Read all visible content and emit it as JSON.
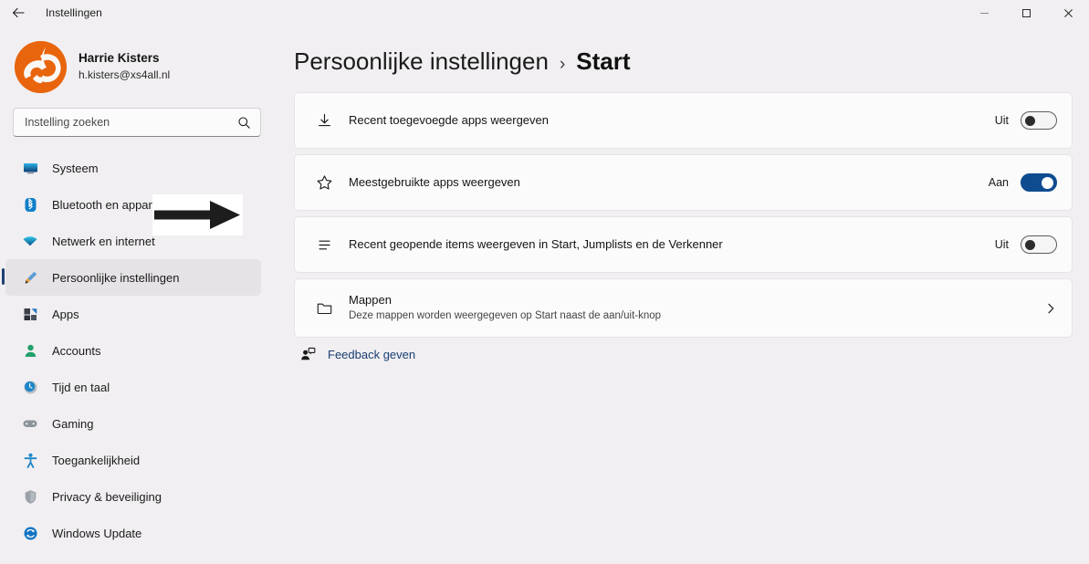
{
  "window": {
    "title": "Instellingen",
    "back_icon": "back-arrow-icon",
    "minimize_label": "—",
    "maximize_label": "□",
    "close_label": "✕"
  },
  "profile": {
    "name": "Harrie Kisters",
    "email": "h.kisters@xs4all.nl",
    "avatar_color": "#e8650d"
  },
  "search": {
    "placeholder": "Instelling zoeken",
    "value": "",
    "icon": "search-icon"
  },
  "sidebar": {
    "items": [
      {
        "label": "Systeem",
        "icon": "monitor-icon",
        "selected": false
      },
      {
        "label": "Bluetooth en apparaten",
        "icon": "bluetooth-icon",
        "selected": false
      },
      {
        "label": "Netwerk en internet",
        "icon": "wifi-icon",
        "selected": false
      },
      {
        "label": "Persoonlijke instellingen",
        "icon": "brush-icon",
        "selected": true
      },
      {
        "label": "Apps",
        "icon": "apps-icon",
        "selected": false
      },
      {
        "label": "Accounts",
        "icon": "person-icon",
        "selected": false
      },
      {
        "label": "Tijd en taal",
        "icon": "clock-icon",
        "selected": false
      },
      {
        "label": "Gaming",
        "icon": "gamepad-icon",
        "selected": false
      },
      {
        "label": "Toegankelijkheid",
        "icon": "accessibility-icon",
        "selected": false
      },
      {
        "label": "Privacy & beveiliging",
        "icon": "shield-icon",
        "selected": false
      },
      {
        "label": "Windows Update",
        "icon": "update-icon",
        "selected": false
      }
    ]
  },
  "breadcrumb": {
    "parent": "Persoonlijke instellingen",
    "separator": "›",
    "current": "Start"
  },
  "settings": {
    "rows": [
      {
        "title": "Recent toegevoegde apps weergeven",
        "icon": "download-icon",
        "state_label": "Uit",
        "state_on": false
      },
      {
        "title": "Meestgebruikte apps weergeven",
        "icon": "star-icon",
        "state_label": "Aan",
        "state_on": true
      },
      {
        "title": "Recent geopende items weergeven in Start, Jumplists en de Verkenner",
        "icon": "list-icon",
        "state_label": "Uit",
        "state_on": false
      }
    ],
    "folders_row": {
      "title": "Mappen",
      "subtitle": "Deze mappen worden weergegeven op Start naast de aan/uit-knop",
      "icon": "folder-icon",
      "chevron": "chevron-right-icon"
    }
  },
  "feedback": {
    "label": "Feedback geven",
    "icon": "feedback-person-icon"
  },
  "annotation": {
    "type": "arrow-right",
    "color": "#1d1d1d"
  },
  "accent_color": "#0f4b8f"
}
